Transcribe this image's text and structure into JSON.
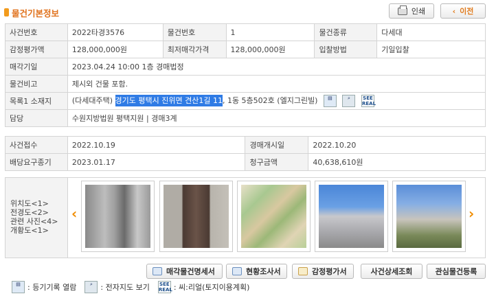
{
  "header": {
    "title": "물건기본정보",
    "print_label": "인쇄",
    "back_label": "이전"
  },
  "basic": {
    "case_no_label": "사건번호",
    "case_no": "2022타경3576",
    "item_no_label": "물건번호",
    "item_no": "1",
    "item_type_label": "물건종류",
    "item_type": "다세대",
    "appraisal_label": "감정평가액",
    "appraisal": "128,000,000원",
    "min_price_label": "최저매각가격",
    "min_price": "128,000,000원",
    "bid_method_label": "입찰방법",
    "bid_method": "기일입찰",
    "sale_date_label": "매각기일",
    "sale_date": "2023.04.24 10:00 1층 경매법정",
    "remark_label": "물건비고",
    "remark": "제시외 건물 포함.",
    "location_label": "목록1 소재지",
    "location_prefix": "(다세대주택) ",
    "location_highlight": "경기도 평택시 진위면 견산1길 11",
    "location_suffix": ", 1동 5층502호 (엘지그린빌)",
    "court_label": "담당",
    "court": "수원지방법원 평택지원 | 경매3계"
  },
  "dates": {
    "receipt_label": "사건접수",
    "receipt": "2022.10.19",
    "start_label": "경매개시일",
    "start": "2022.10.20",
    "dividend_label": "배당요구종기",
    "dividend": "2023.01.17",
    "claim_label": "청구금액",
    "claim": "40,638,610원"
  },
  "photos": {
    "labels": [
      "위치도<1>",
      "전경도<2>",
      "관련 사진<4>",
      "개황도<1>"
    ]
  },
  "actions": {
    "sale_statement": "매각물건명세서",
    "survey": "현황조사서",
    "appraisal_doc": "감정평가서",
    "case_detail": "사건상세조회",
    "watch": "관심물건등록"
  },
  "legend": {
    "registry": ": 등기기록 열람",
    "map": ": 전자지도 보기",
    "real": ": 씨:리얼(토지이용계획)"
  },
  "icons": {
    "real_text": "SEE REAL"
  },
  "colors": {
    "accent": "#e0711b",
    "highlight": "#2f7be5",
    "label_bg": "#f3f3f3"
  }
}
